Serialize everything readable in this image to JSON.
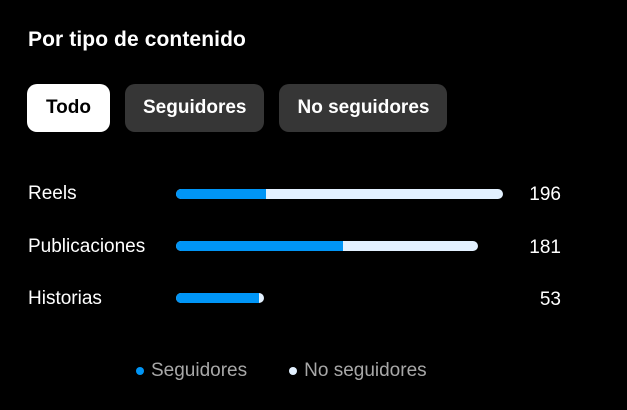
{
  "title": "Por tipo de contenido",
  "filters": [
    {
      "label": "Todo",
      "active": true
    },
    {
      "label": "Seguidores",
      "active": false
    },
    {
      "label": "No seguidores",
      "active": false
    }
  ],
  "rows": [
    {
      "label": "Reels",
      "value": "196",
      "total": 196,
      "followers": 54
    },
    {
      "label": "Publicaciones",
      "value": "181",
      "total": 181,
      "followers": 100
    },
    {
      "label": "Historias",
      "value": "53",
      "total": 53,
      "followers": 50
    }
  ],
  "legend": {
    "followers": "Seguidores",
    "non_followers": "No seguidores"
  },
  "colors": {
    "followers": "#0095f6",
    "non_followers": "#e3f1ff",
    "background": "#000000",
    "active_filter_bg": "#ffffff",
    "inactive_filter_bg": "#363636",
    "legend_text": "#a8a8a8"
  }
}
